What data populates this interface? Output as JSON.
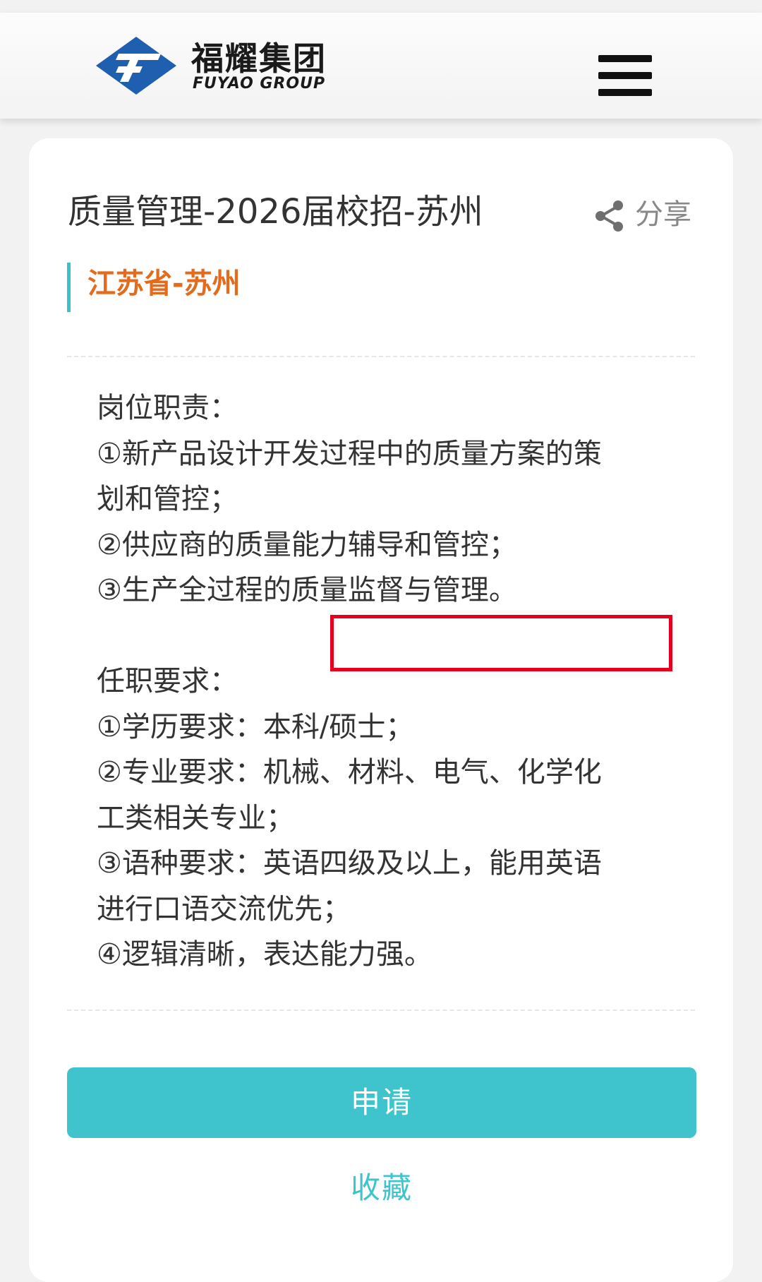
{
  "header": {
    "logo_cn": "福耀集团",
    "logo_en": "FUYAO GROUP",
    "brand_color": "#1f5fb0"
  },
  "job": {
    "title": "质量管理-2026届校招-苏州",
    "share_label": "分享",
    "location": "江苏省-苏州",
    "description_lines": [
      "岗位职责：",
      "①新产品设计开发过程中的质量方案的策",
      "划和管控；",
      "②供应商的质量能力辅导和管控；",
      "③生产全过程的质量监督与管理。",
      "",
      "任职要求：",
      "①学历要求：本科/硕士；",
      "②专业要求：机械、材料、电气、化学化",
      "工类相关专业；",
      "③语种要求：英语四级及以上，能用英语",
      "进行口语交流优先；",
      "④逻辑清晰，表达能力强。"
    ]
  },
  "actions": {
    "apply_label": "申请",
    "favorite_label": "收藏"
  },
  "colors": {
    "accent": "#3fc4ce",
    "location": "#e46a1c",
    "highlight": "#e8001f"
  }
}
